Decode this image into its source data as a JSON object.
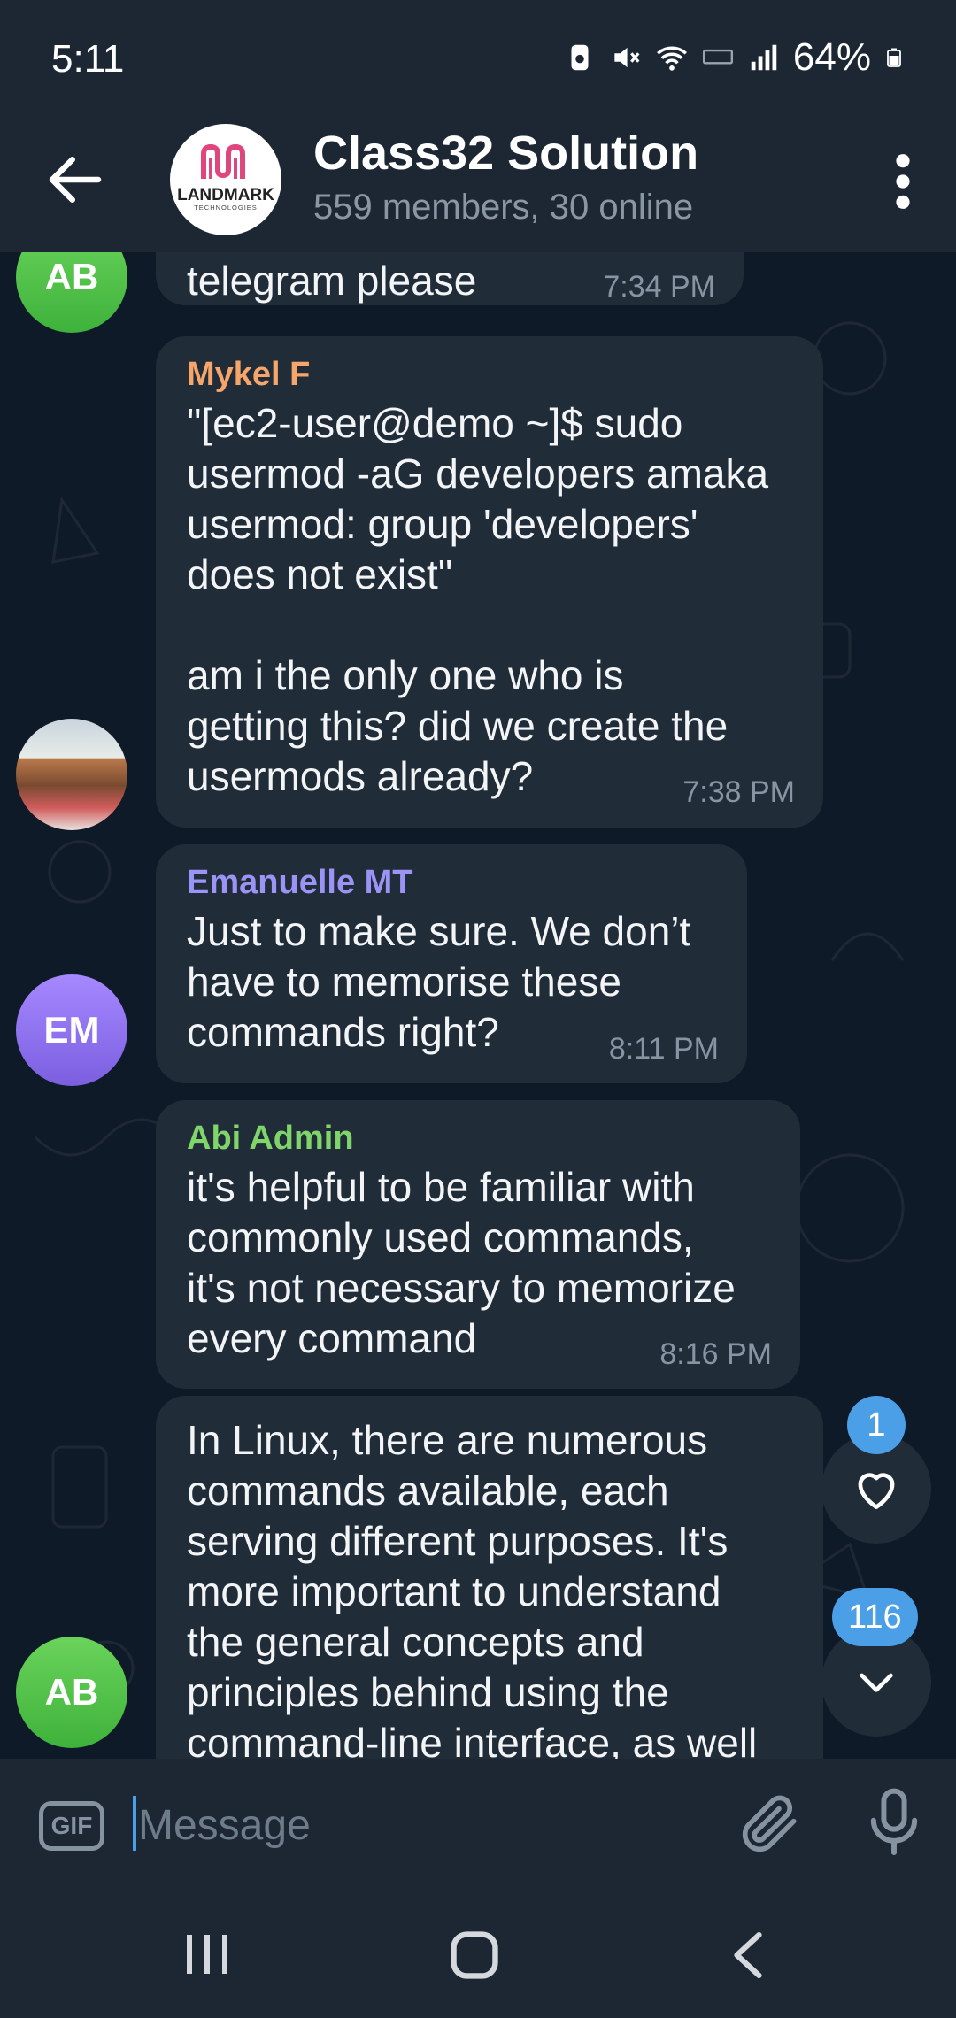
{
  "status_bar": {
    "time": "5:11",
    "battery": "64%"
  },
  "header": {
    "title": "Class32 Solution",
    "subtitle": "559 members, 30 online",
    "logo_text": "LANDMARK",
    "logo_subtext": "TECHNOLOGIES"
  },
  "messages": [
    {
      "avatar": "AB",
      "sender": "",
      "text": "telegram please",
      "time": "7:34 PM"
    },
    {
      "avatar": "",
      "sender": "Mykel F",
      "sender_color": "#f6a66a",
      "text": "\"[ec2-user@demo ~]$ sudo\nusermod -aG developers amaka\nusermod: group 'developers'\ndoes not exist\"\n\nam i the only one who is\ngetting this? did we create the\nusermods already?",
      "time": "7:38 PM"
    },
    {
      "avatar": "EM",
      "sender": "Emanuelle MT",
      "sender_color": "#9b93f5",
      "text": "Just to make sure. We don’t\nhave to memorise these\ncommands right?",
      "time": "8:11 PM"
    },
    {
      "avatar": "",
      "sender": "Abi Admin",
      "sender_color": "#7fd46a",
      "text": "it's helpful to be familiar with\ncommonly used commands,\nit's not necessary to memorize\nevery command",
      "time": "8:16 PM"
    },
    {
      "avatar": "AB",
      "sender": "",
      "text": "In Linux, there are numerous\ncommands available, each\nserving different purposes. It's\nmore important to understand\nthe general concepts and\nprinciples behind using the\ncommand-line interface, as well",
      "time": ""
    }
  ],
  "reactions": {
    "badge": "1",
    "icon": "heart-icon"
  },
  "scroll_down": {
    "badge": "116",
    "icon": "chevron-down-icon"
  },
  "input": {
    "gif_label": "GIF",
    "placeholder": "Message"
  },
  "colors": {
    "background": "#0f1a28",
    "bar": "#1d2733",
    "bubble": "#212c39",
    "accent": "#4a9fe6"
  }
}
